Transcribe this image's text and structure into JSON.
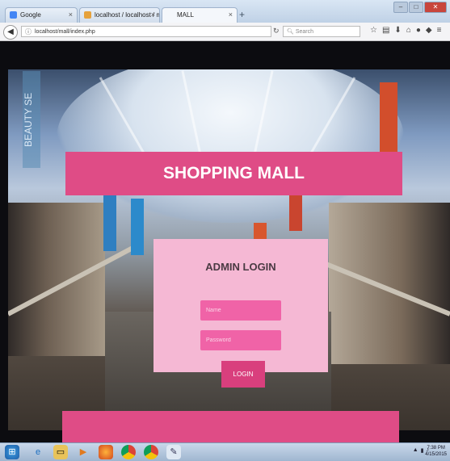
{
  "browser": {
    "tabs": [
      {
        "label": "Google"
      },
      {
        "label": "localhost / localhost / mall..."
      },
      {
        "label": "MALL"
      }
    ],
    "url": "localhost/mall/index.php",
    "search_placeholder": "Search"
  },
  "page": {
    "title": "SHOPPING MALL",
    "background_sign": "BEAUTY SE",
    "login": {
      "heading": "ADMIN LOGIN",
      "name_placeholder": "Name",
      "password_placeholder": "Password",
      "button_label": "LOGIN"
    }
  },
  "taskbar": {
    "time": "7:38 PM",
    "date": "4/15/2015"
  },
  "colors": {
    "band": "#df4c86",
    "panel": "#f5b8d4",
    "field": "#f063a7",
    "button": "#d93f7d"
  }
}
